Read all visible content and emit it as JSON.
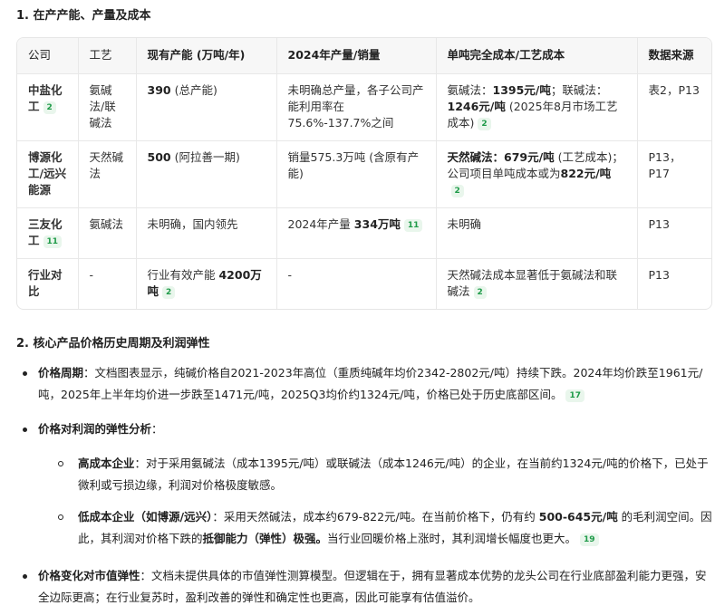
{
  "section1_title": "1. 在产产能、产量及成本",
  "table": {
    "headers": [
      "公司",
      "工艺",
      "现有产能 (万吨/年)",
      "2024年产量/销量",
      "单吨完全成本/工艺成本",
      "数据来源"
    ],
    "rows": [
      [
        [
          {
            "t": "中盐化工"
          },
          {
            "cite": "2"
          }
        ],
        [
          {
            "t": "氨碱法/联碱法"
          }
        ],
        [
          {
            "t": "390",
            "b": true
          },
          {
            "t": " (总产能)"
          }
        ],
        [
          {
            "t": "未明确总产量，各子公司产能利用率在75.6%-137.7%之间"
          }
        ],
        [
          {
            "t": "氨碱法："
          },
          {
            "t": "1395元/吨",
            "b": true
          },
          {
            "t": "；联碱法："
          },
          {
            "t": "1246元/吨",
            "b": true
          },
          {
            "t": " (2025年8月市场工艺成本)"
          },
          {
            "cite": "2"
          }
        ],
        [
          {
            "t": "表2，P13"
          }
        ]
      ],
      [
        [
          {
            "t": "博源化工/远兴能源"
          }
        ],
        [
          {
            "t": "天然碱法"
          }
        ],
        [
          {
            "t": "500",
            "b": true
          },
          {
            "t": " (阿拉善一期)"
          }
        ],
        [
          {
            "t": "销量575.3万吨 (含原有产能)"
          }
        ],
        [
          {
            "t": "天然碱法：679元/吨",
            "b": true
          },
          {
            "t": " (工艺成本)；公司项目单吨成本或为"
          },
          {
            "t": "822元/吨",
            "b": true
          },
          {
            "cite": "2"
          }
        ],
        [
          {
            "t": "P13，P17"
          }
        ]
      ],
      [
        [
          {
            "t": "三友化工"
          },
          {
            "cite": "11"
          }
        ],
        [
          {
            "t": "氨碱法"
          }
        ],
        [
          {
            "t": "未明确，国内领先"
          }
        ],
        [
          {
            "t": "2024年产量 "
          },
          {
            "t": "334万吨",
            "b": true
          },
          {
            "cite": "11"
          }
        ],
        [
          {
            "t": "未明确"
          }
        ],
        [
          {
            "t": "P13"
          }
        ]
      ],
      [
        [
          {
            "t": "行业对比"
          }
        ],
        [
          {
            "t": "-"
          }
        ],
        [
          {
            "t": "行业有效产能 "
          },
          {
            "t": "4200万吨",
            "b": true
          },
          {
            "cite": "2"
          }
        ],
        [
          {
            "t": "-"
          }
        ],
        [
          {
            "t": "天然碱法成本显著低于氨碱法和联碱法"
          },
          {
            "cite": "2"
          }
        ],
        [
          {
            "t": "P13"
          }
        ]
      ]
    ]
  },
  "section2_title": "2. 核心产品价格历史周期及利润弹性",
  "bullets": [
    {
      "level": 1,
      "parts": [
        {
          "t": "价格周期",
          "b": true
        },
        {
          "t": "：文档图表显示，纯碱价格自2021-2023年高位（重质纯碱年均价2342-2802元/吨）持续下跌。2024年均价跌至1961元/吨，2025年上半年均价进一步跌至1471元/吨，2025Q3均价约1324元/吨，价格已处于历史底部区间。"
        },
        {
          "cite": "17"
        }
      ]
    },
    {
      "level": 1,
      "parts": [
        {
          "t": "价格对利润的弹性分析",
          "b": true
        },
        {
          "t": "："
        }
      ]
    },
    {
      "level": 2,
      "parts": [
        {
          "t": "高成本企业",
          "b": true
        },
        {
          "t": "：对于采用氨碱法（成本1395元/吨）或联碱法（成本1246元/吨）的企业，在当前约1324元/吨的价格下，已处于微利或亏损边缘，利润对价格极度敏感。"
        }
      ]
    },
    {
      "level": 2,
      "parts": [
        {
          "t": "低成本企业（如博源/远兴）",
          "b": true
        },
        {
          "t": "：采用天然碱法，成本约679-822元/吨。在当前价格下，仍有约 "
        },
        {
          "t": "500-645元/吨",
          "b": true
        },
        {
          "t": " 的毛利润空间。因此，其利润对价格下跌的"
        },
        {
          "t": "抵御能力（弹性）极强。",
          "b": true
        },
        {
          "t": "当行业回暖价格上涨时，其利润增长幅度也更大。"
        },
        {
          "cite": "19"
        }
      ]
    },
    {
      "level": 1,
      "parts": [
        {
          "t": "价格变化对市值弹性",
          "b": true
        },
        {
          "t": "：文档未提供具体的市值弹性测算模型。但逻辑在于，拥有显著成本优势的龙头公司在行业底部盈利能力更强，安全边际更高；在行业复苏时，盈利改善的弹性和确定性也更高，因此可能享有估值溢价。"
        }
      ]
    }
  ],
  "colors": {
    "cite_bg": "#e9f6ec",
    "cite_text": "#1e9a48",
    "header_bg": "#f7f7f7"
  }
}
